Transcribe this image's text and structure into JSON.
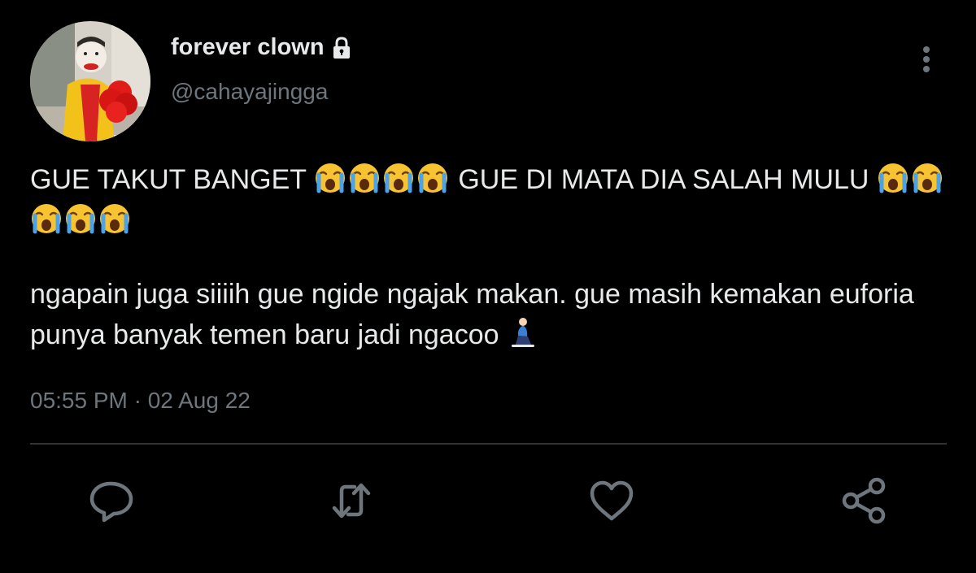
{
  "tweet": {
    "display_name": "forever clown",
    "handle": "@cahayajingga",
    "paragraph1": {
      "text_a": "GUE TAKUT BANGET",
      "text_b": "GUE DI MATA DIA SALAH MULU"
    },
    "paragraph2": {
      "text": "ngapain juga siiiih gue ngide ngajak makan. gue masih kemakan euforia punya banyak temen baru jadi ngacoo"
    },
    "timestamp": "05:55 PM · 02 Aug 22"
  },
  "icons": {
    "lock": "lock-icon",
    "more": "more-vertical-icon",
    "crying_emoji": "loudly-crying-face-emoji",
    "kneeling_emoji": "kneeling-person-emoji",
    "reply": "reply-icon",
    "retweet": "retweet-icon",
    "like": "like-icon",
    "share": "share-icon"
  },
  "colors": {
    "background": "#000000",
    "text_primary": "#e7e9ea",
    "text_secondary": "#6e767d",
    "divider": "#2f3336"
  }
}
